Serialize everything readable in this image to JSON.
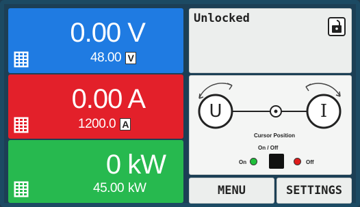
{
  "voltage": {
    "actual": "0.00 V",
    "set": "48.00",
    "unit": "V"
  },
  "current": {
    "actual": "0.00 A",
    "set": "1200.0",
    "unit": "A"
  },
  "power": {
    "actual": "0 kW",
    "set": "45.00",
    "unit": "kW"
  },
  "status": {
    "text": "Unlocked",
    "lock_icon": "unlocked-padlock-icon"
  },
  "control": {
    "left_knob_letter": "U",
    "right_knob_letter": "I",
    "cursor_position_label": "Cursor Position",
    "onoff_label": "On / Off",
    "on_label": "On",
    "off_label": "Off"
  },
  "buttons": {
    "menu": "MENU",
    "settings": "SETTINGS"
  },
  "colors": {
    "voltage": "#1f7be2",
    "current": "#e3202a",
    "power": "#27b94f",
    "led_on": "#1fbf3b",
    "led_off": "#e01c1c"
  }
}
